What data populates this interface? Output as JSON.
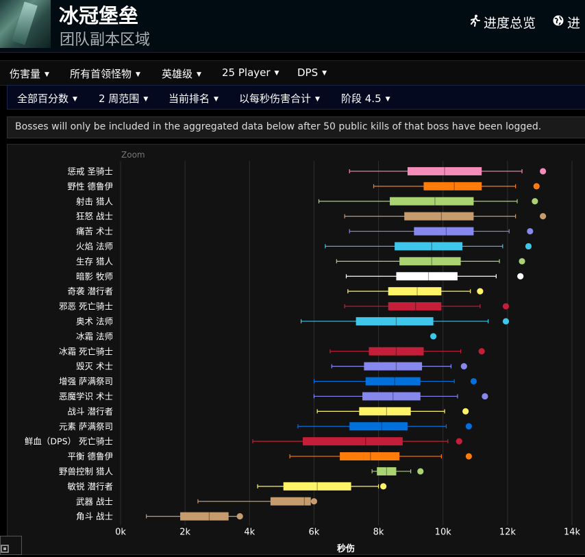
{
  "header": {
    "title": "冰冠堡垒",
    "subtitle": "团队副本区域",
    "links": [
      {
        "icon": "runner-icon",
        "label": "进度总览"
      },
      {
        "icon": "globe-icon",
        "label": "进"
      }
    ]
  },
  "nav_primary": [
    "伤害量",
    "所有首领怪物",
    "英雄级",
    "25 Player",
    "DPS"
  ],
  "nav_secondary": [
    "全部百分数",
    "2 周范围",
    "当前排名",
    "以每秒伤害合计",
    "阶段 4.5"
  ],
  "notice": "Bosses will only be included in the aggregated data below after 50 public kills of that boss have been logged.",
  "chart_data": {
    "type": "boxplot",
    "zoom_label": "Zoom",
    "xlabel": "秒伤",
    "xlim": [
      0,
      14000
    ],
    "xticks": [
      0,
      2000,
      4000,
      6000,
      8000,
      10000,
      12000,
      14000
    ],
    "xtick_labels": [
      "0k",
      "2k",
      "4k",
      "6k",
      "8k",
      "10k",
      "12k",
      "14k"
    ],
    "grid": true,
    "rows": [
      {
        "label": "惩戒 圣骑士",
        "min": 7100,
        "q1": 8900,
        "median": 10050,
        "q3": 11200,
        "max": 12450,
        "outlier": 13100,
        "color": "#f48cba"
      },
      {
        "label": "野性 德鲁伊",
        "min": 7850,
        "q1": 9400,
        "median": 10350,
        "q3": 11200,
        "max": 12250,
        "outlier": 12900,
        "color": "#ff7c0a"
      },
      {
        "label": "射击 猎人",
        "min": 6150,
        "q1": 8350,
        "median": 9750,
        "q3": 10950,
        "max": 12300,
        "outlier": 12850,
        "color": "#aad372"
      },
      {
        "label": "狂怒 战士",
        "min": 6950,
        "q1": 8800,
        "median": 9950,
        "q3": 10950,
        "max": 12250,
        "outlier": 13100,
        "color": "#c69b6d"
      },
      {
        "label": "痛苦 术士",
        "min": 7100,
        "q1": 9100,
        "median": 10100,
        "q3": 10950,
        "max": 12050,
        "outlier": 12700,
        "color": "#8788ee"
      },
      {
        "label": "火焰 法师",
        "min": 6350,
        "q1": 8500,
        "median": 9650,
        "q3": 10600,
        "max": 11850,
        "outlier": 12650,
        "color": "#3fc7eb"
      },
      {
        "label": "生存 猎人",
        "min": 6700,
        "q1": 8650,
        "median": 9650,
        "q3": 10550,
        "max": 11750,
        "outlier": 12450,
        "color": "#aad372"
      },
      {
        "label": "暗影 牧师",
        "min": 7000,
        "q1": 8550,
        "median": 9550,
        "q3": 10450,
        "max": 11650,
        "outlier": 12400,
        "color": "#ffffff"
      },
      {
        "label": "奇袭 潜行者",
        "min": 7050,
        "q1": 8300,
        "median": 9200,
        "q3": 9950,
        "max": 10850,
        "outlier": 11150,
        "color": "#fff468"
      },
      {
        "label": "邪恶 死亡骑士",
        "min": 6950,
        "q1": 8300,
        "median": 9150,
        "q3": 9950,
        "max": 11150,
        "outlier": 11950,
        "color": "#c41e3a"
      },
      {
        "label": "奥术 法师",
        "min": 5600,
        "q1": 7300,
        "median": 8550,
        "q3": 9700,
        "max": 11400,
        "outlier": 11950,
        "color": "#3fc7eb"
      },
      {
        "label": "冰霜 法师",
        "outlier": 9700,
        "color": "#3fc7eb"
      },
      {
        "label": "冰霜 死亡骑士",
        "min": 6500,
        "q1": 7700,
        "median": 8550,
        "q3": 9400,
        "max": 10550,
        "outlier": 11200,
        "color": "#c41e3a"
      },
      {
        "label": "毁灭 术士",
        "min": 6550,
        "q1": 7550,
        "median": 8550,
        "q3": 9350,
        "max": 10250,
        "outlier": 10650,
        "color": "#8788ee"
      },
      {
        "label": "增强 萨满祭司",
        "min": 6000,
        "q1": 7600,
        "median": 8500,
        "q3": 9300,
        "max": 10350,
        "outlier": 10950,
        "color": "#0070dd"
      },
      {
        "label": "恶魔学识 术士",
        "min": 6000,
        "q1": 7500,
        "median": 8450,
        "q3": 9300,
        "max": 10450,
        "outlier": 11300,
        "color": "#8788ee"
      },
      {
        "label": "战斗 潜行者",
        "min": 6100,
        "q1": 7400,
        "median": 8250,
        "q3": 9000,
        "max": 10050,
        "outlier": 10700,
        "color": "#fff468"
      },
      {
        "label": "元素 萨满祭司",
        "min": 5500,
        "q1": 7100,
        "median": 8100,
        "q3": 8900,
        "max": 10100,
        "outlier": 10800,
        "color": "#0070dd"
      },
      {
        "label": "鲜血（DPS） 死亡骑士",
        "min": 4100,
        "q1": 5650,
        "median": 7600,
        "q3": 8750,
        "max": 10150,
        "outlier": 10500,
        "color": "#c41e3a"
      },
      {
        "label": "平衡 德鲁伊",
        "min": 5250,
        "q1": 6800,
        "median": 7750,
        "q3": 8650,
        "max": 9950,
        "outlier": 10800,
        "color": "#ff7c0a"
      },
      {
        "label": "野兽控制 猎人",
        "min": 7800,
        "q1": 7950,
        "median": 8250,
        "q3": 8550,
        "max": 9000,
        "outlier": 9300,
        "color": "#aad372"
      },
      {
        "label": "敏锐 潜行者",
        "min": 4250,
        "q1": 5050,
        "median": 6100,
        "q3": 7150,
        "max": 8000,
        "outlier": 8150,
        "color": "#fff468"
      },
      {
        "label": "武器 战士",
        "min": 2400,
        "q1": 4650,
        "median": 5700,
        "q3": 5900,
        "max": 6000,
        "outlier": 6000,
        "color": "#c69b6d"
      },
      {
        "label": "角斗 战士",
        "min": 800,
        "q1": 1850,
        "median": 2750,
        "q3": 3350,
        "max": 3650,
        "outlier": 3700,
        "color": "#c69b6d"
      }
    ]
  }
}
